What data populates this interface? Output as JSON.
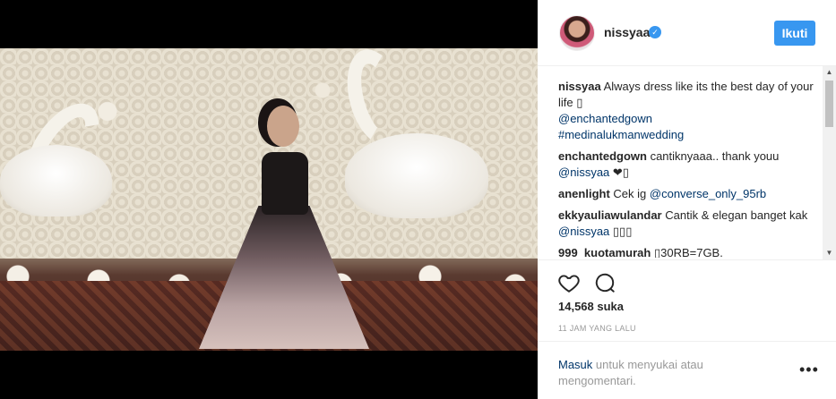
{
  "post": {
    "username": "nissyaa",
    "verified_glyph": "✓",
    "follow_label": "Ikuti",
    "likes": "14,568 suka",
    "timestamp": "11 JAM YANG LALU"
  },
  "comments": [
    {
      "author": "nissyaa",
      "text": "Always dress like its the best day of your life ▯",
      "links": [
        "@enchantedgown",
        "#medinalukmanwedding"
      ]
    },
    {
      "author": "enchantedgown",
      "text": "cantiknyaaa.. thank youu",
      "link": "@nissyaa",
      "suffix": "❤▯"
    },
    {
      "author": "anenlight",
      "text": "Cek ig",
      "link": "@converse_only_95rb"
    },
    {
      "author": "ekkyauliawulandar",
      "text": "Cantik & elegan banget kak",
      "link": "@nissyaa",
      "suffix": "▯▯▯"
    },
    {
      "author": "999_kuotamurah",
      "text": "▯30RB=7GB."
    }
  ],
  "footer": {
    "login_label": "Masuk",
    "login_suffix": "untuk menyukai atau mengomentari.",
    "more_label": "•••"
  },
  "icons": {
    "like": "heart-icon",
    "comment": "comment-icon",
    "more": "more-options-icon",
    "verified": "verified-badge-icon"
  },
  "colors": {
    "accent": "#3897f0",
    "link": "#003569",
    "text": "#262626",
    "muted": "#999999"
  }
}
